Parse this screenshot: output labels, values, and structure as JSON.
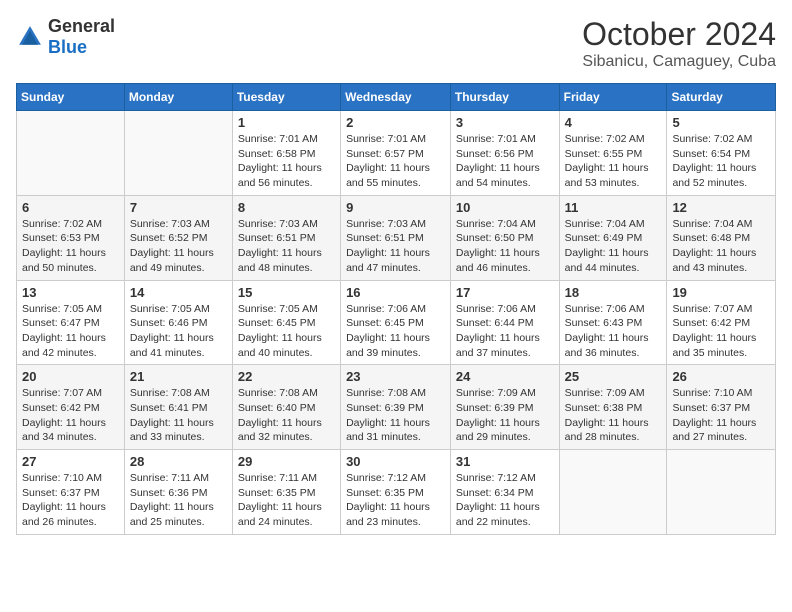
{
  "logo": {
    "general": "General",
    "blue": "Blue"
  },
  "title": "October 2024",
  "subtitle": "Sibanicu, Camaguey, Cuba",
  "weekdays": [
    "Sunday",
    "Monday",
    "Tuesday",
    "Wednesday",
    "Thursday",
    "Friday",
    "Saturday"
  ],
  "weeks": [
    [
      {
        "day": "",
        "sunrise": "",
        "sunset": "",
        "daylight": ""
      },
      {
        "day": "",
        "sunrise": "",
        "sunset": "",
        "daylight": ""
      },
      {
        "day": "1",
        "sunrise": "Sunrise: 7:01 AM",
        "sunset": "Sunset: 6:58 PM",
        "daylight": "Daylight: 11 hours and 56 minutes."
      },
      {
        "day": "2",
        "sunrise": "Sunrise: 7:01 AM",
        "sunset": "Sunset: 6:57 PM",
        "daylight": "Daylight: 11 hours and 55 minutes."
      },
      {
        "day": "3",
        "sunrise": "Sunrise: 7:01 AM",
        "sunset": "Sunset: 6:56 PM",
        "daylight": "Daylight: 11 hours and 54 minutes."
      },
      {
        "day": "4",
        "sunrise": "Sunrise: 7:02 AM",
        "sunset": "Sunset: 6:55 PM",
        "daylight": "Daylight: 11 hours and 53 minutes."
      },
      {
        "day": "5",
        "sunrise": "Sunrise: 7:02 AM",
        "sunset": "Sunset: 6:54 PM",
        "daylight": "Daylight: 11 hours and 52 minutes."
      }
    ],
    [
      {
        "day": "6",
        "sunrise": "Sunrise: 7:02 AM",
        "sunset": "Sunset: 6:53 PM",
        "daylight": "Daylight: 11 hours and 50 minutes."
      },
      {
        "day": "7",
        "sunrise": "Sunrise: 7:03 AM",
        "sunset": "Sunset: 6:52 PM",
        "daylight": "Daylight: 11 hours and 49 minutes."
      },
      {
        "day": "8",
        "sunrise": "Sunrise: 7:03 AM",
        "sunset": "Sunset: 6:51 PM",
        "daylight": "Daylight: 11 hours and 48 minutes."
      },
      {
        "day": "9",
        "sunrise": "Sunrise: 7:03 AM",
        "sunset": "Sunset: 6:51 PM",
        "daylight": "Daylight: 11 hours and 47 minutes."
      },
      {
        "day": "10",
        "sunrise": "Sunrise: 7:04 AM",
        "sunset": "Sunset: 6:50 PM",
        "daylight": "Daylight: 11 hours and 46 minutes."
      },
      {
        "day": "11",
        "sunrise": "Sunrise: 7:04 AM",
        "sunset": "Sunset: 6:49 PM",
        "daylight": "Daylight: 11 hours and 44 minutes."
      },
      {
        "day": "12",
        "sunrise": "Sunrise: 7:04 AM",
        "sunset": "Sunset: 6:48 PM",
        "daylight": "Daylight: 11 hours and 43 minutes."
      }
    ],
    [
      {
        "day": "13",
        "sunrise": "Sunrise: 7:05 AM",
        "sunset": "Sunset: 6:47 PM",
        "daylight": "Daylight: 11 hours and 42 minutes."
      },
      {
        "day": "14",
        "sunrise": "Sunrise: 7:05 AM",
        "sunset": "Sunset: 6:46 PM",
        "daylight": "Daylight: 11 hours and 41 minutes."
      },
      {
        "day": "15",
        "sunrise": "Sunrise: 7:05 AM",
        "sunset": "Sunset: 6:45 PM",
        "daylight": "Daylight: 11 hours and 40 minutes."
      },
      {
        "day": "16",
        "sunrise": "Sunrise: 7:06 AM",
        "sunset": "Sunset: 6:45 PM",
        "daylight": "Daylight: 11 hours and 39 minutes."
      },
      {
        "day": "17",
        "sunrise": "Sunrise: 7:06 AM",
        "sunset": "Sunset: 6:44 PM",
        "daylight": "Daylight: 11 hours and 37 minutes."
      },
      {
        "day": "18",
        "sunrise": "Sunrise: 7:06 AM",
        "sunset": "Sunset: 6:43 PM",
        "daylight": "Daylight: 11 hours and 36 minutes."
      },
      {
        "day": "19",
        "sunrise": "Sunrise: 7:07 AM",
        "sunset": "Sunset: 6:42 PM",
        "daylight": "Daylight: 11 hours and 35 minutes."
      }
    ],
    [
      {
        "day": "20",
        "sunrise": "Sunrise: 7:07 AM",
        "sunset": "Sunset: 6:42 PM",
        "daylight": "Daylight: 11 hours and 34 minutes."
      },
      {
        "day": "21",
        "sunrise": "Sunrise: 7:08 AM",
        "sunset": "Sunset: 6:41 PM",
        "daylight": "Daylight: 11 hours and 33 minutes."
      },
      {
        "day": "22",
        "sunrise": "Sunrise: 7:08 AM",
        "sunset": "Sunset: 6:40 PM",
        "daylight": "Daylight: 11 hours and 32 minutes."
      },
      {
        "day": "23",
        "sunrise": "Sunrise: 7:08 AM",
        "sunset": "Sunset: 6:39 PM",
        "daylight": "Daylight: 11 hours and 31 minutes."
      },
      {
        "day": "24",
        "sunrise": "Sunrise: 7:09 AM",
        "sunset": "Sunset: 6:39 PM",
        "daylight": "Daylight: 11 hours and 29 minutes."
      },
      {
        "day": "25",
        "sunrise": "Sunrise: 7:09 AM",
        "sunset": "Sunset: 6:38 PM",
        "daylight": "Daylight: 11 hours and 28 minutes."
      },
      {
        "day": "26",
        "sunrise": "Sunrise: 7:10 AM",
        "sunset": "Sunset: 6:37 PM",
        "daylight": "Daylight: 11 hours and 27 minutes."
      }
    ],
    [
      {
        "day": "27",
        "sunrise": "Sunrise: 7:10 AM",
        "sunset": "Sunset: 6:37 PM",
        "daylight": "Daylight: 11 hours and 26 minutes."
      },
      {
        "day": "28",
        "sunrise": "Sunrise: 7:11 AM",
        "sunset": "Sunset: 6:36 PM",
        "daylight": "Daylight: 11 hours and 25 minutes."
      },
      {
        "day": "29",
        "sunrise": "Sunrise: 7:11 AM",
        "sunset": "Sunset: 6:35 PM",
        "daylight": "Daylight: 11 hours and 24 minutes."
      },
      {
        "day": "30",
        "sunrise": "Sunrise: 7:12 AM",
        "sunset": "Sunset: 6:35 PM",
        "daylight": "Daylight: 11 hours and 23 minutes."
      },
      {
        "day": "31",
        "sunrise": "Sunrise: 7:12 AM",
        "sunset": "Sunset: 6:34 PM",
        "daylight": "Daylight: 11 hours and 22 minutes."
      },
      {
        "day": "",
        "sunrise": "",
        "sunset": "",
        "daylight": ""
      },
      {
        "day": "",
        "sunrise": "",
        "sunset": "",
        "daylight": ""
      }
    ]
  ]
}
